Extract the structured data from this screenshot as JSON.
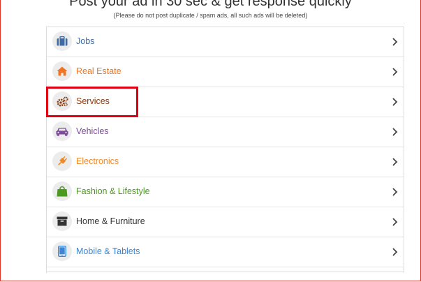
{
  "heading": "Post your ad in 30 sec & get response quickly",
  "subheading": "(Please do not post duplicate / spam ads, all such ads will be deleted)",
  "categories": [
    {
      "label": "Jobs",
      "icon": "briefcase-icon",
      "color": "#3d6aa3"
    },
    {
      "label": "Real Estate",
      "icon": "house-icon",
      "color": "#f07422"
    },
    {
      "label": "Services",
      "icon": "gears-icon",
      "color": "#8a3b0f"
    },
    {
      "label": "Vehicles",
      "icon": "car-icon",
      "color": "#7d4a9c"
    },
    {
      "label": "Electronics",
      "icon": "plug-icon",
      "color": "#ef8a2a"
    },
    {
      "label": "Fashion & Lifestyle",
      "icon": "shopping-bag-icon",
      "color": "#4a9a1e"
    },
    {
      "label": "Home & Furniture",
      "icon": "box-icon",
      "color": "#333333"
    },
    {
      "label": "Mobile & Tablets",
      "icon": "tablet-icon",
      "color": "#3b86d6"
    }
  ],
  "highlight_color": "#e00012"
}
